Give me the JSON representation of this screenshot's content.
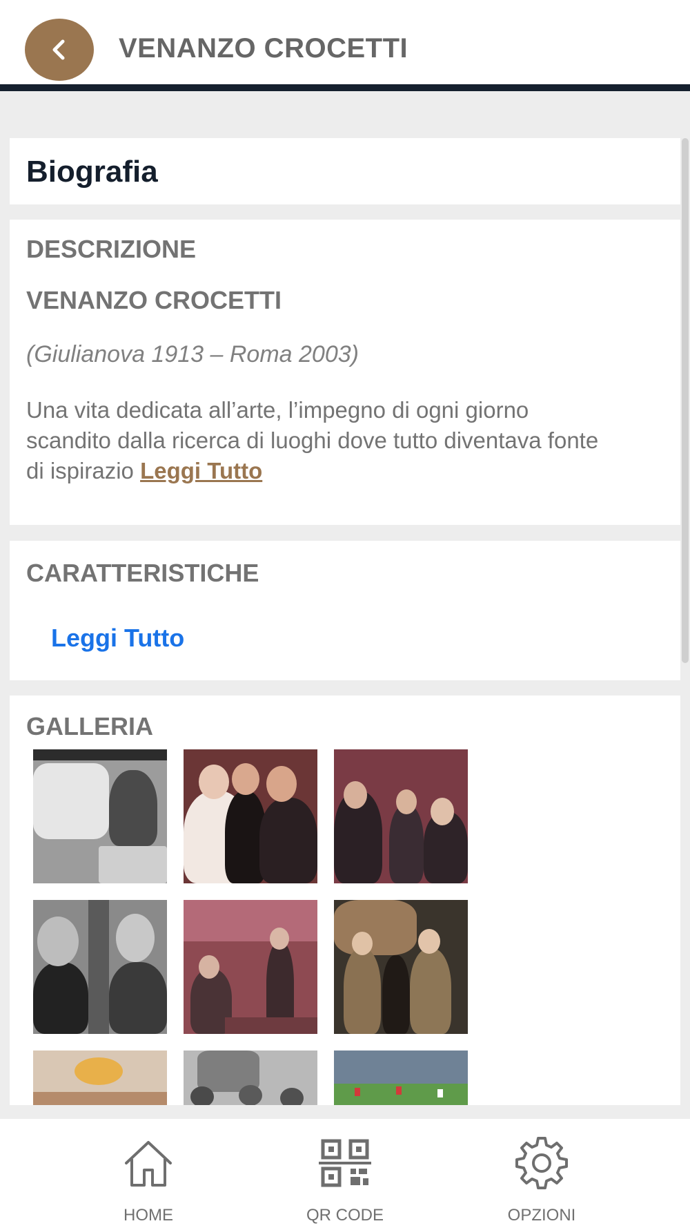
{
  "header": {
    "title": "VENANZO CROCETTI",
    "back_icon": "chevron-left-icon",
    "accent_color": "#9a7650"
  },
  "biography": {
    "heading": "Biografia"
  },
  "description": {
    "label": "DESCRIZIONE",
    "name": "VENANZO CROCETTI",
    "dates": "(Giulianova 1913 – Roma 2003)",
    "text": "Una vita dedicata all’arte, l’impegno di ogni giorno scandito dalla ricerca di luoghi dove tutto diventava fonte di ispirazio",
    "read_more": "Leggi Tutto"
  },
  "characteristics": {
    "label": "CARATTERISTICHE",
    "link": "Leggi Tutto"
  },
  "gallery": {
    "label": "GALLERIA",
    "photos": [
      "sculptor-at-work-photo",
      "pope-handshake-photo",
      "reception-crowd-photo",
      "two-men-conversation-photo",
      "formal-hall-seated-photo",
      "men-in-coats-statue-photo",
      "chandelier-hall-photo",
      "group-outdoors-photo",
      "landscape-flags-photo"
    ]
  },
  "bottom_nav": [
    {
      "label": "HOME",
      "icon": "home-icon"
    },
    {
      "label": "QR CODE",
      "icon": "qr-code-icon"
    },
    {
      "label": "OPZIONI",
      "icon": "gear-icon"
    }
  ]
}
